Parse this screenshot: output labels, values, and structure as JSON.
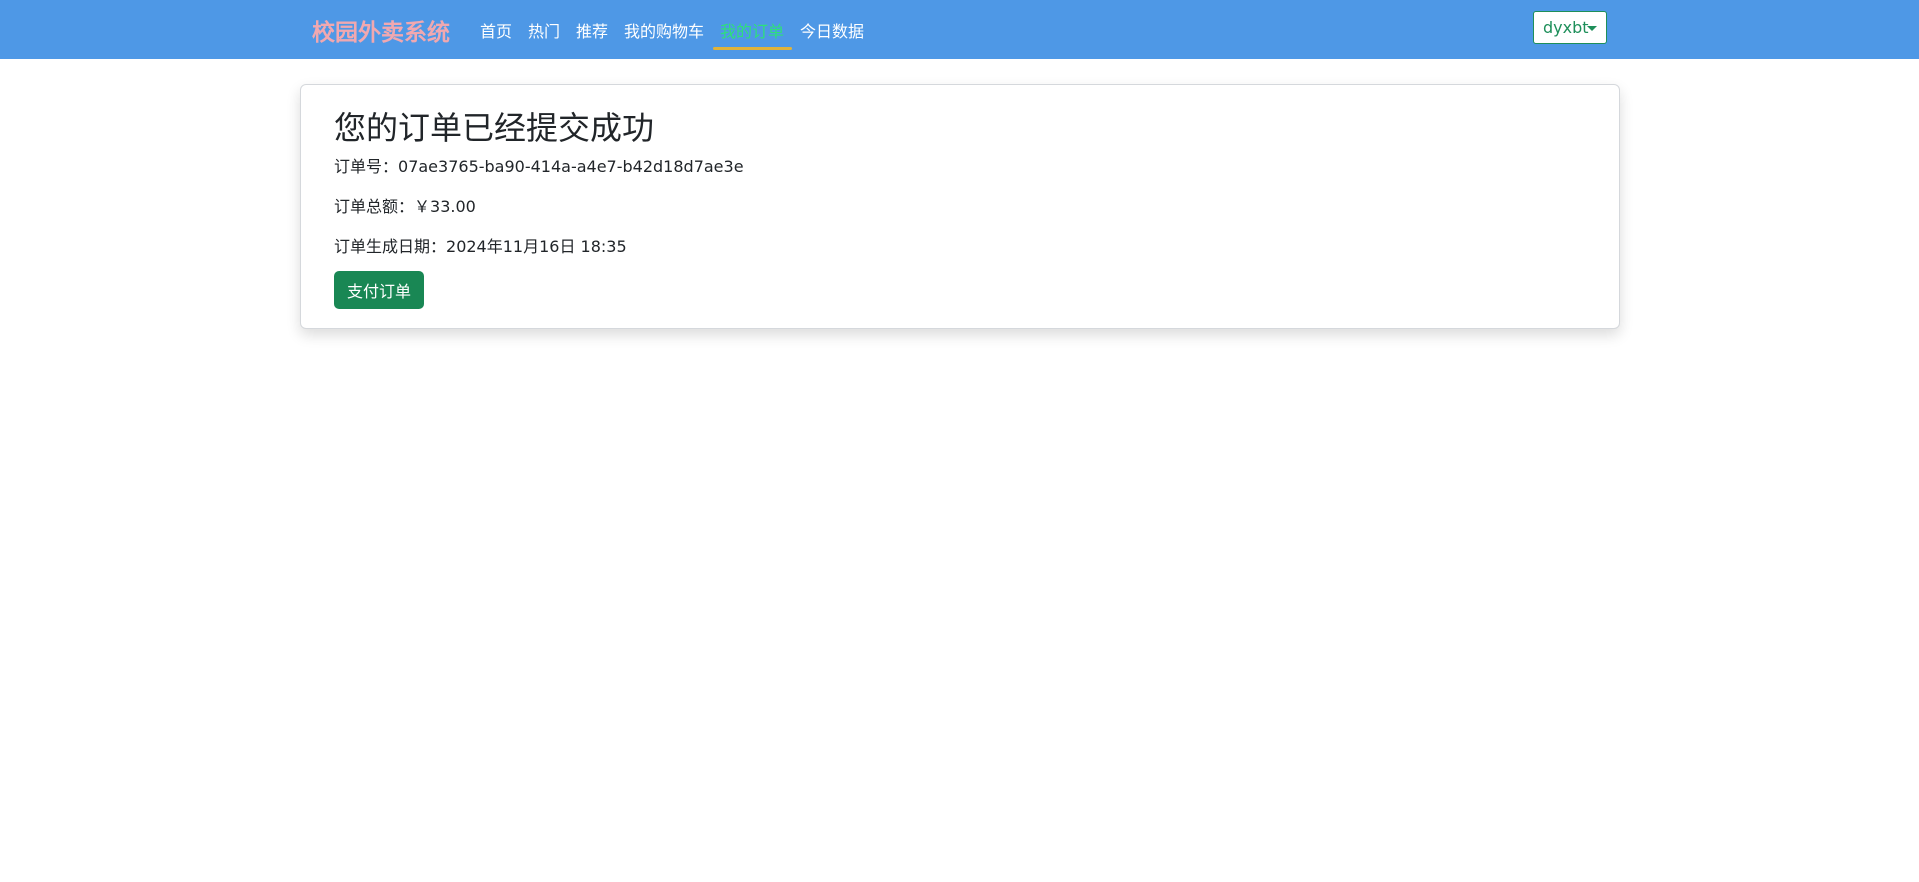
{
  "navbar": {
    "brand": "校园外卖系统",
    "items": [
      {
        "label": "首页"
      },
      {
        "label": "热门"
      },
      {
        "label": "推荐"
      },
      {
        "label": "我的购物车"
      },
      {
        "label": "我的订单",
        "active": true
      },
      {
        "label": "今日数据"
      }
    ],
    "user": "dyxbt"
  },
  "order": {
    "title": "您的订单已经提交成功",
    "id_label": "订单号：",
    "id_value": "07ae3765-ba90-414a-a4e7-b42d18d7ae3e",
    "total_label": "订单总额：",
    "total_value": "￥33.00",
    "date_label": "订单生成日期：",
    "date_value": "2024年11月16日 18:35",
    "pay_label": "支付订单"
  },
  "colors": {
    "navbar_bg": "#4e98e6",
    "brand": "#f0a8b0",
    "active_nav": "#2ee07a",
    "active_underline": "#e0b33a",
    "pay_button": "#198754"
  }
}
